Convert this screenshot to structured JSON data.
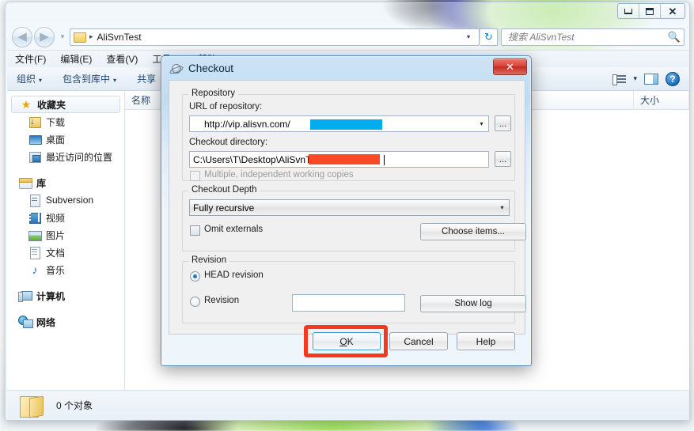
{
  "explorer": {
    "window_controls": {
      "minimize": "—",
      "maximize": "□",
      "close": "✕"
    },
    "address": {
      "folder_name": "AliSvnTest",
      "separator": "▸",
      "dropdown_caret": "▾",
      "refresh": "↻"
    },
    "search": {
      "placeholder": "搜索 AliSvnTest",
      "icon": "search-icon"
    },
    "menu": [
      {
        "label": "文件(F)"
      },
      {
        "label": "编辑(E)"
      },
      {
        "label": "查看(V)"
      },
      {
        "label": "工具(T)"
      },
      {
        "label": "帮助(H)"
      }
    ],
    "toolbar": {
      "items": [
        {
          "label": "组织",
          "caret": "▾"
        },
        {
          "label": "包含到库中",
          "caret": "▾"
        },
        {
          "label": "共享",
          "caret": "▾"
        }
      ],
      "view_caret": "▾"
    },
    "nav_pane": {
      "groups": [
        {
          "header": "收藏夹",
          "icon": "star-icon",
          "items": [
            {
              "label": "下载",
              "icon": "download-folder-icon"
            },
            {
              "label": "桌面",
              "icon": "desktop-icon"
            },
            {
              "label": "最近访问的位置",
              "icon": "recent-places-icon"
            }
          ]
        },
        {
          "header": "库",
          "icon": "library-icon",
          "items": [
            {
              "label": "Subversion",
              "icon": "subversion-library-icon"
            },
            {
              "label": "视频",
              "icon": "video-library-icon"
            },
            {
              "label": "图片",
              "icon": "pictures-library-icon"
            },
            {
              "label": "文档",
              "icon": "documents-library-icon"
            },
            {
              "label": "音乐",
              "icon": "music-library-icon"
            }
          ]
        },
        {
          "header": "计算机",
          "icon": "computer-icon",
          "items": []
        },
        {
          "header": "网络",
          "icon": "network-icon",
          "items": []
        }
      ]
    },
    "columns": [
      {
        "label": "名称"
      },
      {
        "label": ""
      },
      {
        "label": ""
      },
      {
        "label": "大小"
      }
    ],
    "status": {
      "text": "0 个对象",
      "icon": "folder-icon"
    }
  },
  "dialog": {
    "title": "Checkout",
    "icon": "tortoisesvn-icon",
    "close_label": "✕",
    "repository": {
      "group_title": "Repository",
      "url_label": "URL of repository:",
      "url_value": "http://vip.alisvn.com/",
      "url_redacted": true,
      "url_redaction_color": "#00aeef",
      "url_browse_label": "...",
      "url_caret": "▾",
      "directory_label": "Checkout directory:",
      "directory_value": "C:\\Users\\T\\Desktop\\AliSvnTest\\tes",
      "directory_redacted": true,
      "directory_redaction_color": "#fa4a25",
      "directory_browse_label": "...",
      "multiple_copies_label": "Multiple, independent working copies",
      "multiple_copies_checked": false,
      "multiple_copies_disabled": true
    },
    "depth": {
      "group_title": "Checkout Depth",
      "selected": "Fully recursive",
      "caret": "▾",
      "omit_externals_label": "Omit externals",
      "omit_externals_checked": false,
      "choose_items_label": "Choose items..."
    },
    "revision": {
      "group_title": "Revision",
      "head_label": "HEAD revision",
      "head_selected": true,
      "revision_label": "Revision",
      "revision_selected": false,
      "revision_value": "",
      "show_log_label": "Show log"
    },
    "buttons": {
      "ok": "OK",
      "ok_accesskey": "O",
      "cancel": "Cancel",
      "help": "Help"
    },
    "highlight": {
      "target": "ok-button",
      "color": "#f4391e"
    }
  }
}
